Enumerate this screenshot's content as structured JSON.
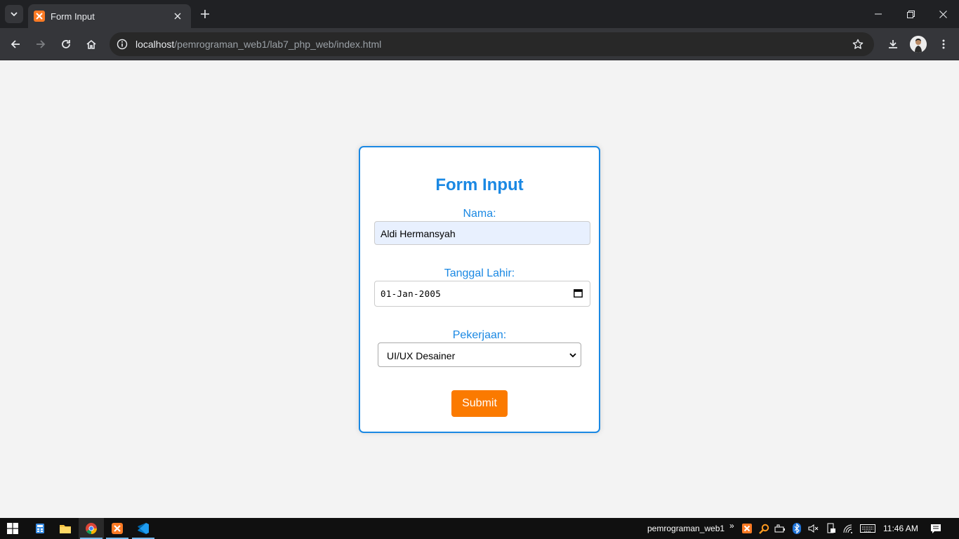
{
  "browser": {
    "tab_title": "Form Input",
    "url_host": "localhost",
    "url_path": "/pemrograman_web1/lab7_php_web/index.html"
  },
  "form": {
    "title": "Form Input",
    "nama_label": "Nama:",
    "nama_value": "Aldi Hermansyah",
    "tanggal_label": "Tanggal Lahir:",
    "tanggal_value": "01-Jan-2005",
    "pekerjaan_label": "Pekerjaan:",
    "pekerjaan_selected": "UI/UX Desainer",
    "submit_label": "Submit"
  },
  "colors": {
    "accent": "#1a88e3",
    "button": "#fb7a00",
    "page_bg": "#f3f3f3"
  },
  "taskbar": {
    "folder_label": "pemrograman_web1",
    "time": "11:46 AM"
  }
}
